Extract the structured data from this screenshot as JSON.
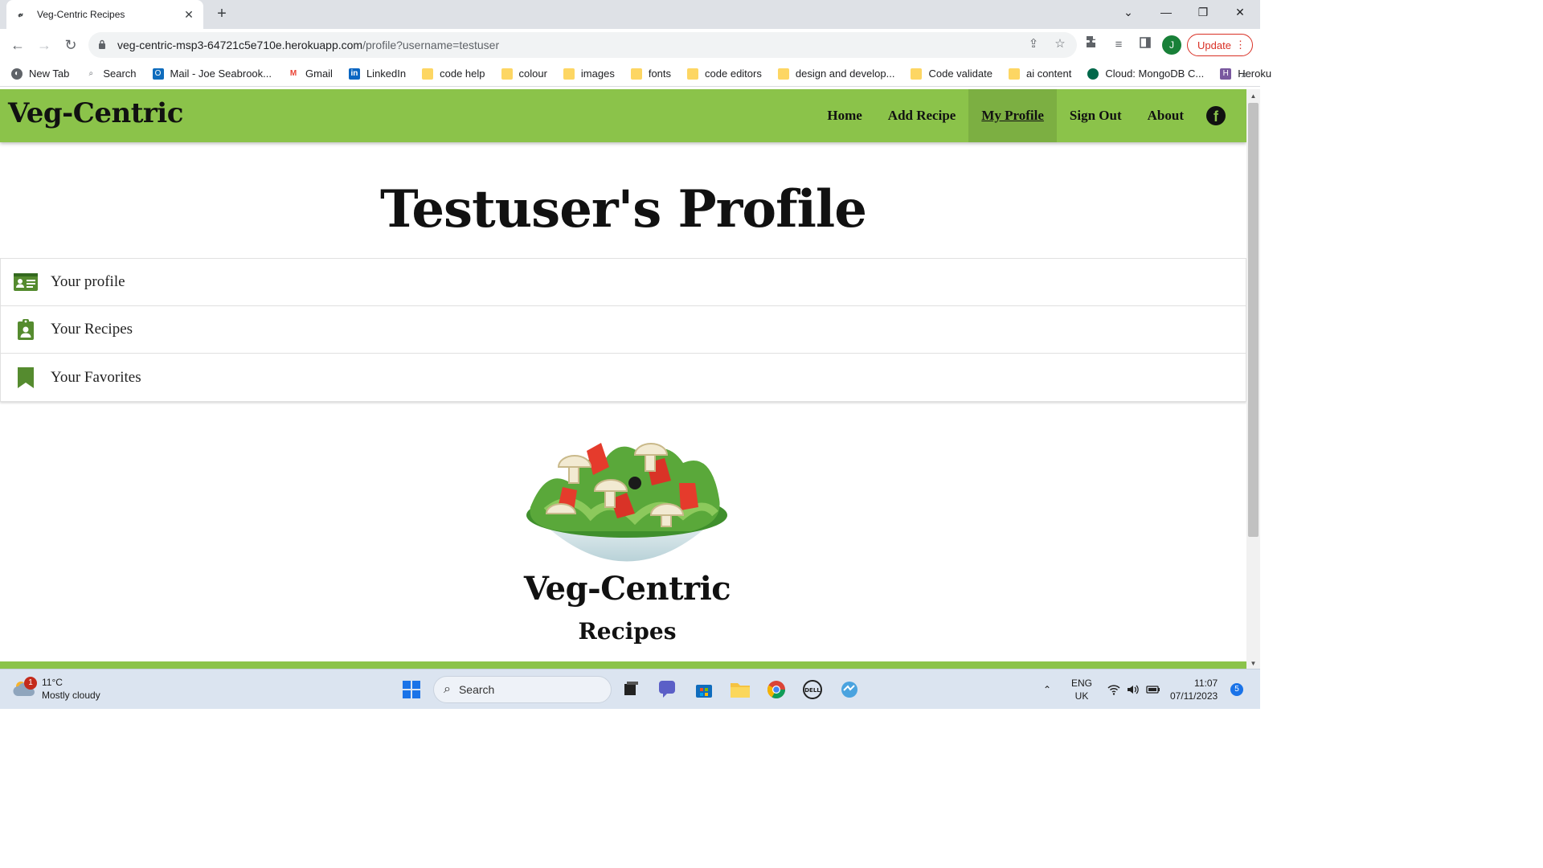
{
  "browser": {
    "tab_title": "Veg-Centric Recipes",
    "tab_favicon": "veg-icon",
    "url_host": "veg-centric-msp3-64721c5e710e.herokuapp.com",
    "url_path": "/profile?username=testuser",
    "profile_initial": "J",
    "update_label": "Update",
    "bookmarks": [
      {
        "label": "New Tab",
        "icon": "globe-icon"
      },
      {
        "label": "Search",
        "icon": "search-icon"
      },
      {
        "label": "Mail - Joe Seabrook...",
        "icon": "outlook-icon"
      },
      {
        "label": "Gmail",
        "icon": "gmail-icon"
      },
      {
        "label": "LinkedIn",
        "icon": "linkedin-icon"
      },
      {
        "label": "code help",
        "icon": "folder-icon"
      },
      {
        "label": "colour",
        "icon": "folder-icon"
      },
      {
        "label": "images",
        "icon": "folder-icon"
      },
      {
        "label": "fonts",
        "icon": "folder-icon"
      },
      {
        "label": "code editors",
        "icon": "folder-icon"
      },
      {
        "label": "design and develop...",
        "icon": "folder-icon"
      },
      {
        "label": "Code validate",
        "icon": "folder-icon"
      },
      {
        "label": "ai content",
        "icon": "folder-icon"
      },
      {
        "label": "Cloud: MongoDB C...",
        "icon": "mongodb-icon"
      },
      {
        "label": "Heroku",
        "icon": "heroku-icon"
      }
    ]
  },
  "site": {
    "brand": "Veg-Centric",
    "nav": [
      {
        "label": "Home",
        "active": false
      },
      {
        "label": "Add Recipe",
        "active": false
      },
      {
        "label": "My Profile",
        "active": true
      },
      {
        "label": "Sign Out",
        "active": false
      },
      {
        "label": "About",
        "active": false
      }
    ],
    "accent_color": "#8bc34a",
    "icon_color": "#558b2f"
  },
  "main": {
    "title": "Testuser's Profile",
    "menu": [
      {
        "label": "Your profile",
        "icon": "id-card-icon"
      },
      {
        "label": "Your Recipes",
        "icon": "clipboard-user-icon"
      },
      {
        "label": "Your Favorites",
        "icon": "bookmark-icon"
      }
    ],
    "logo_word": "Veg-Centric",
    "logo_sub": "Recipes"
  },
  "taskbar": {
    "weather_badge": "1",
    "temperature": "11°C",
    "condition": "Mostly cloudy",
    "search_label": "Search",
    "lang_line1": "ENG",
    "lang_line2": "UK",
    "time": "11:07",
    "date": "07/11/2023",
    "notifications": "5"
  }
}
